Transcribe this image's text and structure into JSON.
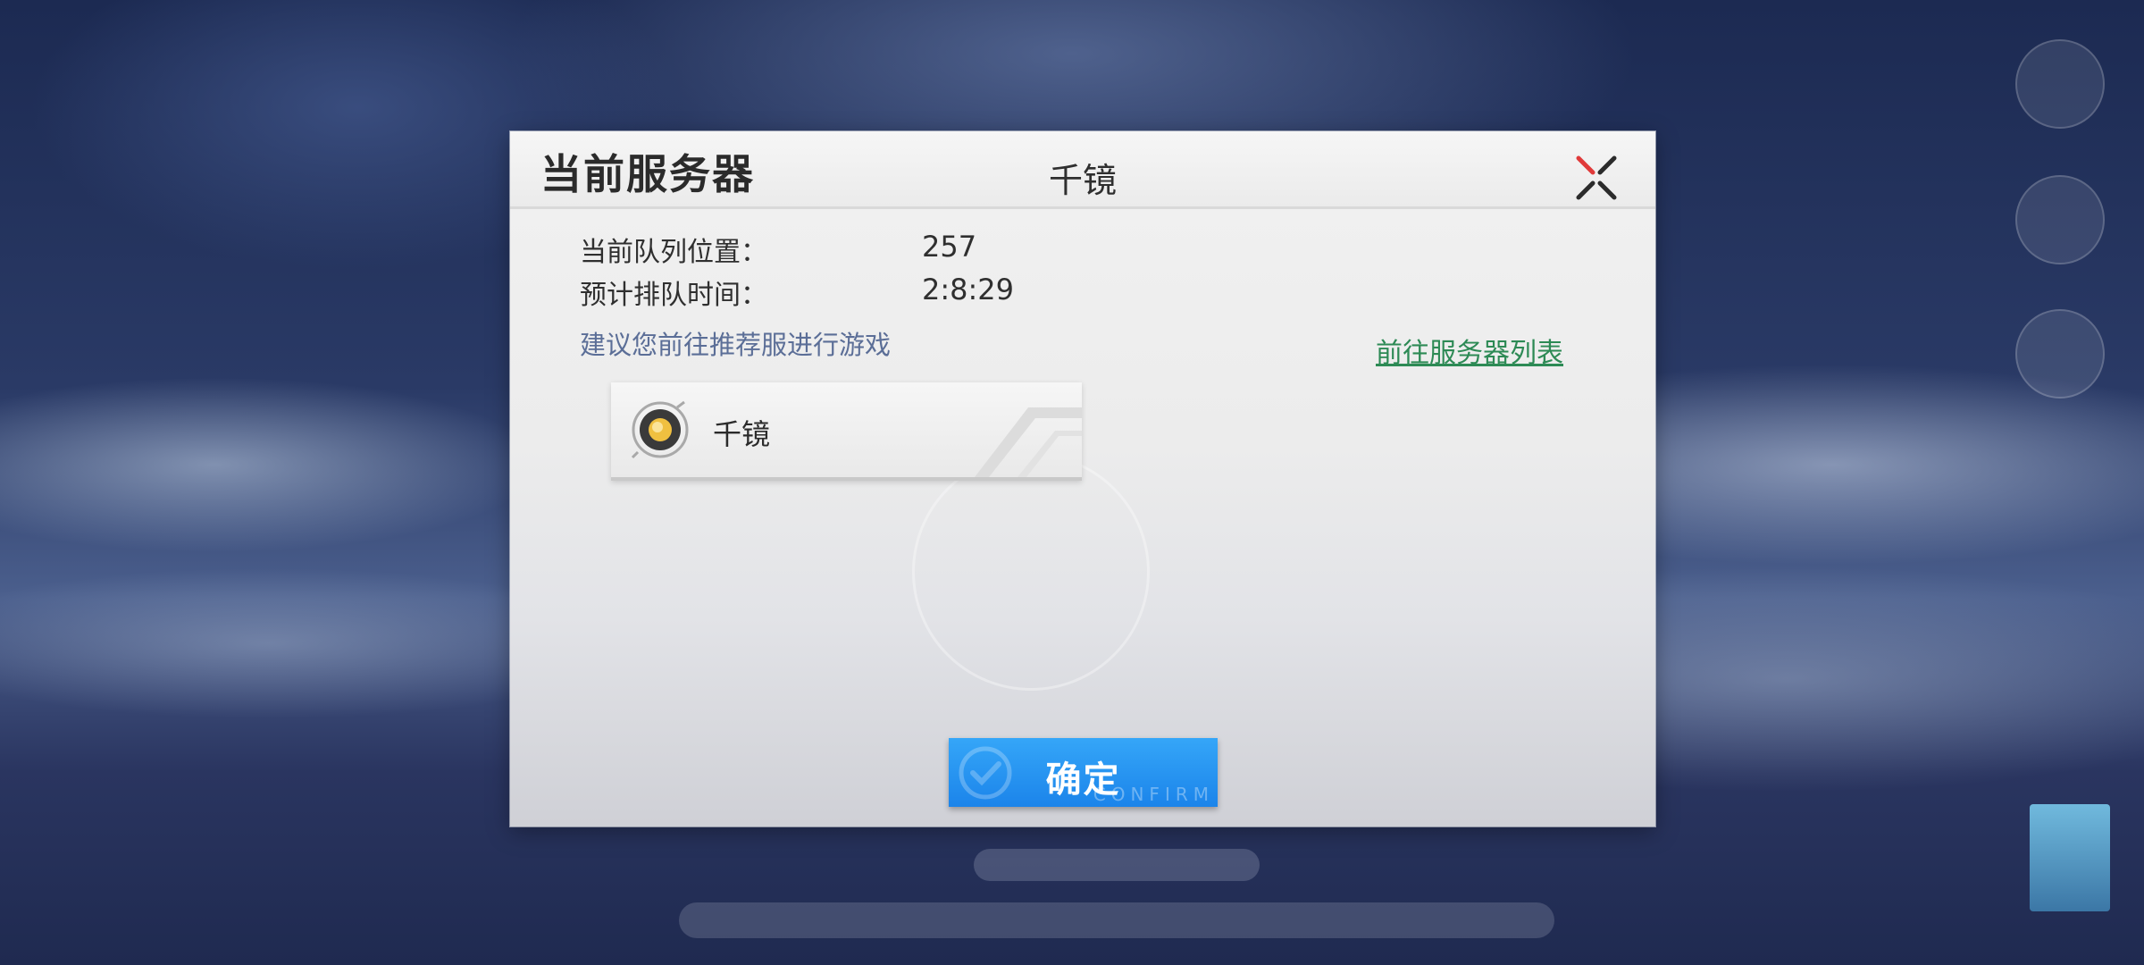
{
  "dialog": {
    "title": "当前服务器",
    "current_server": "千镜",
    "queue_position_label": "当前队列位置：",
    "queue_position_value": "257",
    "wait_time_label": "预计排队时间：",
    "wait_time_value": "2:8:29",
    "suggestion_text": "建议您前往推荐服进行游戏",
    "goto_server_list_label": "前往服务器列表",
    "recommended_server": {
      "name": "千镜"
    },
    "confirm_label": "确定",
    "confirm_sub_label": "CONFIRM"
  },
  "icons": {
    "close": "close-icon",
    "server": "server-status-icon",
    "confirm": "check-icon"
  },
  "colors": {
    "confirm_button": "#1b84ea",
    "link": "#2d8a55",
    "suggestion": "#5b6e97",
    "close_accent": "#e03a3a"
  }
}
